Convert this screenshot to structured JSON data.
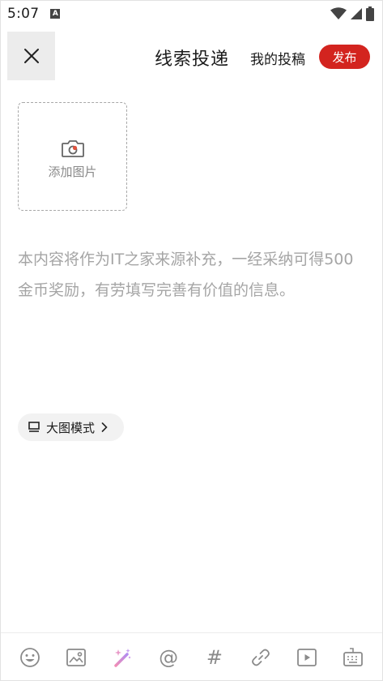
{
  "status_bar": {
    "time": "5:07",
    "notification_icon": "A"
  },
  "header": {
    "title": "线索投递",
    "my_posts_label": "我的投稿",
    "publish_label": "发布"
  },
  "upload": {
    "label": "添加图片"
  },
  "editor": {
    "placeholder": "本内容将作为IT之家来源补充，一经采纳可得500金币奖励，有劳填写完善有价值的信息。"
  },
  "mode_toggle": {
    "label": "大图模式"
  },
  "toolbar": {
    "at_symbol": "@",
    "hash_symbol": "#",
    "items": [
      "emoji-icon",
      "image-icon",
      "magic-wand-icon",
      "mention-icon",
      "hashtag-icon",
      "link-icon",
      "video-icon",
      "keyboard-icon"
    ]
  },
  "colors": {
    "accent": "#d3241f",
    "placeholder": "#a5a5a5",
    "icon": "#8a8a8a"
  }
}
